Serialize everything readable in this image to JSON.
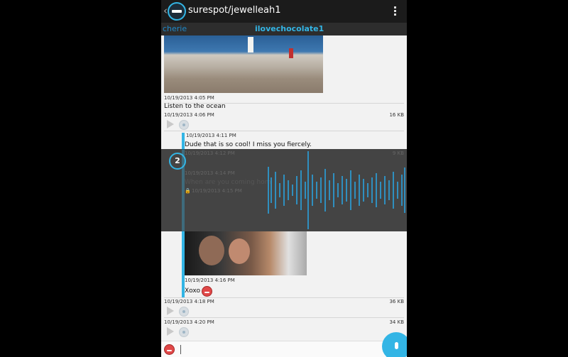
{
  "app": {
    "title": "surespot/jewelleah1",
    "tabs": [
      "cherie",
      "ilovechocolate1"
    ],
    "accent": "#33b5e5",
    "icons": [
      "back-arrow-icon",
      "app-logo-icon",
      "overflow-menu-icon",
      "play-icon",
      "voice-dot-icon",
      "emoji-icon",
      "mic-icon",
      "lock-icon"
    ]
  },
  "messages": {
    "m1_ts": "10/19/2013 4:05 PM",
    "m2_text": "Listen to the ocean",
    "m2_ts": "10/19/2013 4:06 PM",
    "m2_size": "16 KB",
    "m3_ts": "10/19/2013 4:11 PM",
    "m3_text": "Dude that is so cool! I miss you fiercely.",
    "m4_ts": "10/19/2013 4:12 PM",
    "m4_size": "9 KB",
    "m5_ts": "10/19/2013 4:14 PM",
    "m5_text": "When are you coming hom",
    "m6_ts": "10/19/2013 4:15 PM",
    "m7_ts": "10/19/2013 4:16 PM",
    "m7_text": "Xoxo",
    "m8_ts": "10/19/2013 4:18 PM",
    "m8_size": "36 KB",
    "m9_ts": "10/19/2013 4:20 PM",
    "m9_size": "34 KB"
  },
  "voice_overlay": {
    "badge": "2"
  }
}
